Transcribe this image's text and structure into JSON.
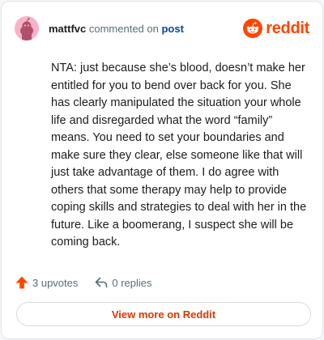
{
  "header": {
    "username": "mattfvc",
    "commented_text": " commented on ",
    "post_link": "post",
    "brand_wordmark": "reddit",
    "avatar_color": "#f7b3c7",
    "brand_color": "#ff4500"
  },
  "comment": {
    "body": "NTA: just because she’s blood, doesn’t make her entitled for you to bend over back for you. She has clearly manipulated the situation your whole life and disregarded what the word “family” means. You need to set your boundaries and make sure they clear, else someone like that will just take advantage of them. I do agree with others that some therapy may help to provide coping skills and strategies to deal with her in the future. Like a boomerang, I suspect she will be coming back."
  },
  "actions": {
    "upvotes_label": "3 upvotes",
    "replies_label": "0 replies",
    "upvote_icon": "upvote-arrow-icon",
    "reply_icon": "reply-arrow-icon"
  },
  "footer": {
    "view_more_label": "View more on Reddit",
    "accent_color": "#d93a00"
  }
}
